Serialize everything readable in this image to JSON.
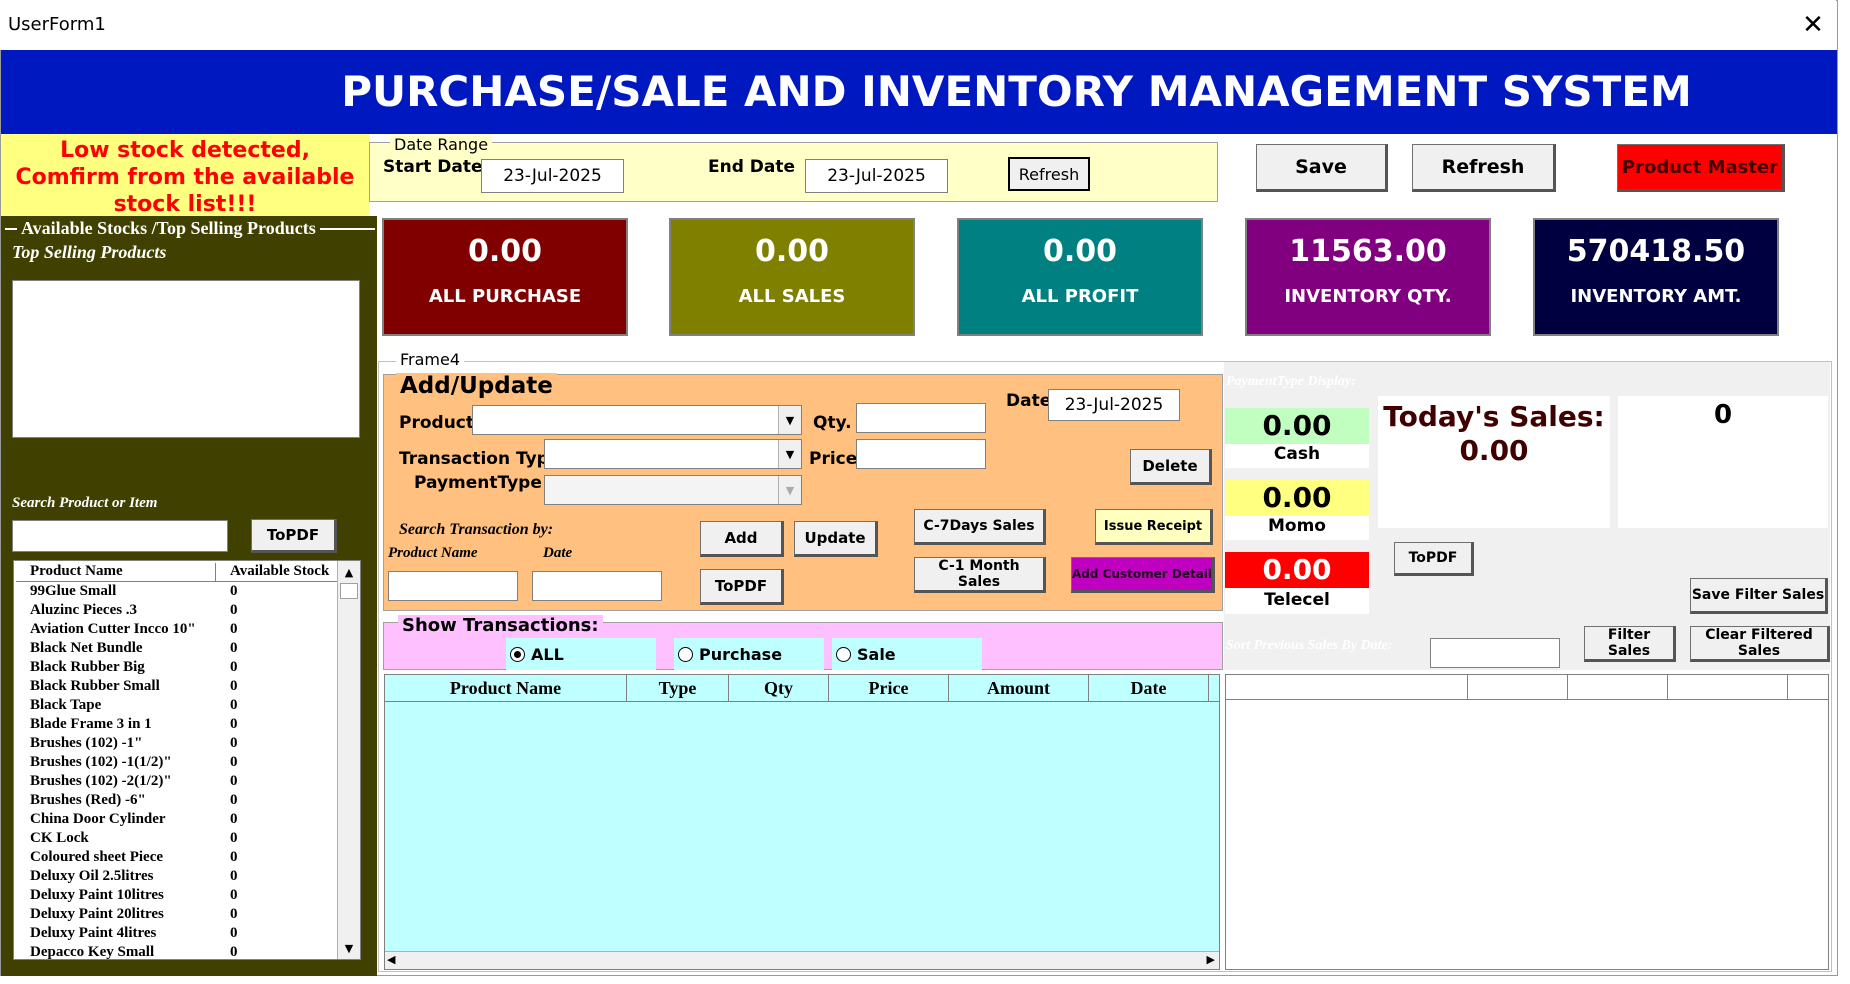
{
  "window": {
    "title": "UserForm1",
    "close_glyph": "✕"
  },
  "header": {
    "title": "PURCHASE/SALE AND INVENTORY MANAGEMENT SYSTEM"
  },
  "alert": {
    "text": "Low stock detected, Comfirm from the available stock list!!!"
  },
  "date_range": {
    "caption": "Date Range",
    "start_label": "Start Date",
    "start_value": "23-Jul-2025",
    "end_label": "End Date",
    "end_value": "23-Jul-2025",
    "refresh_label": "Refresh"
  },
  "toolbar": {
    "save": "Save",
    "refresh": "Refresh",
    "product_master": "Product Master"
  },
  "stats": [
    {
      "value": "0.00",
      "caption": "ALL PURCHASE",
      "color": "#800000"
    },
    {
      "value": "0.00",
      "caption": "ALL SALES",
      "color": "#808000"
    },
    {
      "value": "0.00",
      "caption": "ALL PROFIT",
      "color": "#008080"
    },
    {
      "value": "11563.00",
      "caption": "INVENTORY QTY.",
      "color": "#800080"
    },
    {
      "value": "570418.50",
      "caption": "INVENTORY AMT.",
      "color": "#000040"
    }
  ],
  "left_panel": {
    "caption": "Available Stocks /Top Selling Products",
    "top_selling_label": "Top Selling Products",
    "search_label": "Search Product or Item",
    "topdf": "ToPDF",
    "columns": [
      "Product Name",
      "Available Stock"
    ],
    "items": [
      {
        "name": "99Glue Small",
        "stock": "0"
      },
      {
        "name": "Aluzinc Pieces .3",
        "stock": "0"
      },
      {
        "name": "Aviation Cutter Incco 10\"",
        "stock": "0"
      },
      {
        "name": "Black Net Bundle",
        "stock": "0"
      },
      {
        "name": "Black Rubber Big",
        "stock": "0"
      },
      {
        "name": "Black Rubber Small",
        "stock": "0"
      },
      {
        "name": "Black Tape",
        "stock": "0"
      },
      {
        "name": "Blade Frame 3 in 1",
        "stock": "0"
      },
      {
        "name": "Brushes (102) -1\"",
        "stock": "0"
      },
      {
        "name": "Brushes (102) -1(1/2)\"",
        "stock": "0"
      },
      {
        "name": "Brushes (102) -2(1/2)\"",
        "stock": "0"
      },
      {
        "name": "Brushes (Red) -6\"",
        "stock": "0"
      },
      {
        "name": "China Door Cylinder",
        "stock": "0"
      },
      {
        "name": "CK Lock",
        "stock": "0"
      },
      {
        "name": "Coloured sheet Piece",
        "stock": "0"
      },
      {
        "name": "Deluxy Oil 2.5litres",
        "stock": "0"
      },
      {
        "name": "Deluxy Paint 10litres",
        "stock": "0"
      },
      {
        "name": "Deluxy Paint 20litres",
        "stock": "0"
      },
      {
        "name": "Deluxy Paint 4litres",
        "stock": "0"
      },
      {
        "name": "Depacco Key Small",
        "stock": "0"
      }
    ]
  },
  "frame4": {
    "caption": "Frame4"
  },
  "add_update": {
    "title": "Add/Update",
    "product_label": "Product",
    "qty_label": "Qty.",
    "date_label": "Date",
    "date_value": "23-Jul-2025",
    "transaction_type_label": "Transaction Type",
    "price_label": "Price",
    "payment_type_label": "PaymentType",
    "delete": "Delete",
    "search_by_label": "Search Transaction by:",
    "product_name_label": "Product Name",
    "date_search_label": "Date",
    "add": "Add",
    "update": "Update",
    "topdf": "ToPDF",
    "c7days": "C-7Days Sales",
    "c1month": "C-1 Month Sales",
    "issue_receipt": "Issue Receipt",
    "add_customer": "Add Customer Detail"
  },
  "show_transactions": {
    "title": "Show Transactions:",
    "options": [
      "ALL",
      "Purchase",
      "Sale"
    ],
    "selected": "ALL"
  },
  "grid": {
    "columns": [
      "Product Name",
      "Type",
      "Qty",
      "Price",
      "Amount",
      "Date"
    ]
  },
  "payment_display": {
    "caption": "PaymentType Display:",
    "cash_value": "0.00",
    "cash_label": "Cash",
    "momo_value": "0.00",
    "momo_label": "Momo",
    "telecel_value": "0.00",
    "telecel_label": "Telecel",
    "todays_sales_label": "Today's Sales:",
    "todays_sales_value": "0.00",
    "count_value": "0",
    "topdf": "ToPDF",
    "save_filter": "Save Filter Sales",
    "sort_label": "Sort Previous Sales By Date:",
    "filter_sales": "Filter Sales",
    "clear_filtered": "Clear Filtered Sales"
  }
}
